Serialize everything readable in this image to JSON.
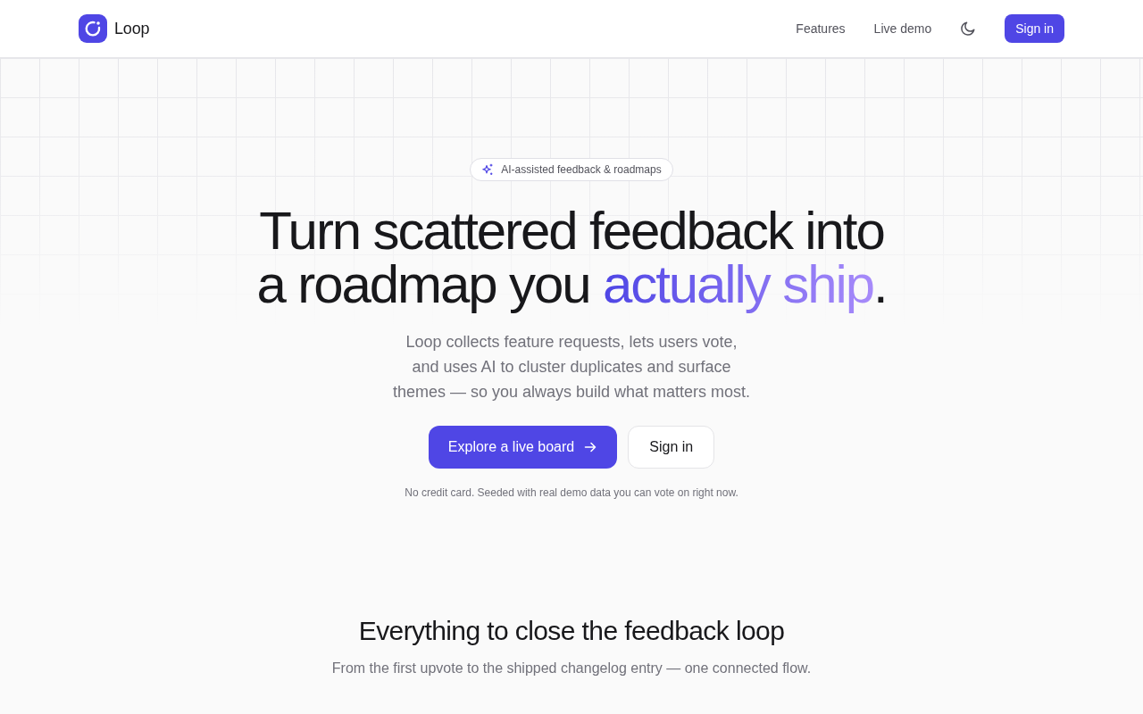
{
  "navbar": {
    "brand": "Loop",
    "links": [
      "Features",
      "Live demo"
    ],
    "sign_in": "Sign in"
  },
  "hero": {
    "badge": "AI-assisted feedback & roadmaps",
    "headline": {
      "text": "Turn scattered feedback into a roadmap you",
      "highlight": "actually ship",
      "end": "."
    },
    "description": "Loop collects feature requests, lets users vote, and uses AI to cluster duplicates and surface themes — so you always build what matters most.",
    "primary_button": "Explore a live board",
    "secondary_button": "Sign in",
    "note": "No credit card. Seeded with real demo data you can vote on right now."
  },
  "features": {
    "title": "Everything to close the feedback loop",
    "subtitle": "From the first upvote to the shipped changelog entry — one connected flow."
  }
}
